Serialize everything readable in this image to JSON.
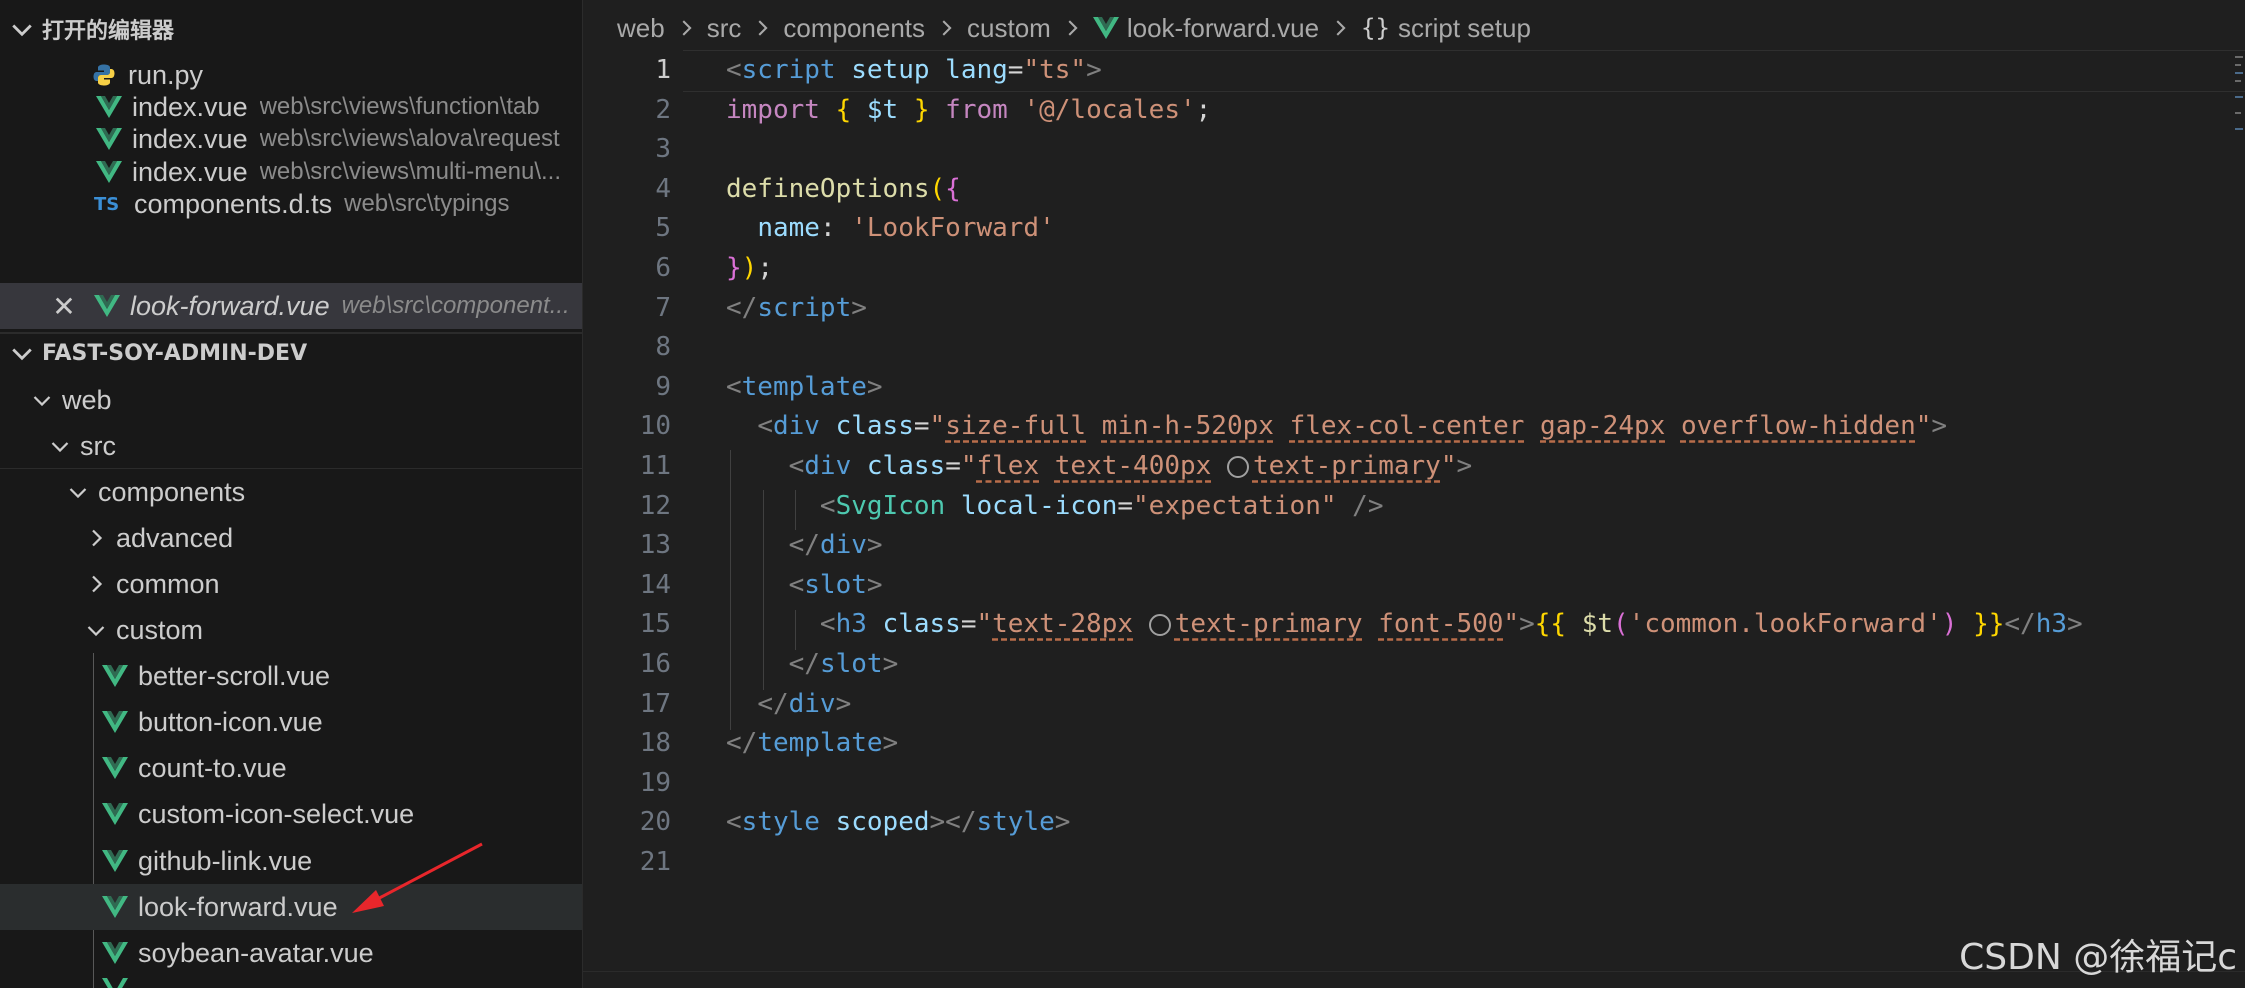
{
  "open_editors": {
    "header": "打开的编辑器",
    "items": [
      {
        "name": "run.py",
        "desc": "",
        "icon": "python-icon"
      },
      {
        "name": "index.vue",
        "desc": "web\\src\\views\\function\\tab",
        "icon": "vue-icon"
      },
      {
        "name": "index.vue",
        "desc": "web\\src\\views\\alova\\request",
        "icon": "vue-icon"
      },
      {
        "name": "index.vue",
        "desc": "web\\src\\views\\multi-menu\\...",
        "icon": "vue-icon"
      },
      {
        "name": "components.d.ts",
        "desc": "web\\src\\typings",
        "icon": "ts-icon",
        "icon_text": "TS"
      },
      {
        "name": "look-forward.vue",
        "desc": "web\\src\\component...",
        "icon": "vue-icon",
        "close": "✕"
      }
    ]
  },
  "explorer": {
    "project": "FAST-SOY-ADMIN-DEV",
    "tree": [
      {
        "label": "web",
        "type": "folder-open"
      },
      {
        "label": "src",
        "type": "folder-open"
      },
      {
        "label": "components",
        "type": "folder-open"
      },
      {
        "label": "advanced",
        "type": "folder-closed"
      },
      {
        "label": "common",
        "type": "folder-closed"
      },
      {
        "label": "custom",
        "type": "folder-open"
      },
      {
        "label": "better-scroll.vue",
        "type": "file"
      },
      {
        "label": "button-icon.vue",
        "type": "file"
      },
      {
        "label": "count-to.vue",
        "type": "file"
      },
      {
        "label": "custom-icon-select.vue",
        "type": "file"
      },
      {
        "label": "github-link.vue",
        "type": "file"
      },
      {
        "label": "look-forward.vue",
        "type": "file",
        "selected": true
      },
      {
        "label": "soybean-avatar.vue",
        "type": "file"
      }
    ]
  },
  "breadcrumb": {
    "parts": [
      "web",
      "src",
      "components",
      "custom",
      "look-forward.vue",
      "script setup"
    ],
    "symbol_icon": "{}"
  },
  "editor": {
    "current_line": 1,
    "line_numbers": [
      "1",
      "2",
      "3",
      "4",
      "5",
      "6",
      "7",
      "8",
      "9",
      "10",
      "11",
      "12",
      "13",
      "14",
      "15",
      "16",
      "17",
      "18",
      "19",
      "20",
      "21"
    ],
    "lines": [
      [
        [
          "tok-p",
          "<"
        ],
        [
          "tok-tag",
          "script"
        ],
        [
          "tok-w",
          " "
        ],
        [
          "tok-attr",
          "setup"
        ],
        [
          "tok-w",
          " "
        ],
        [
          "tok-attr",
          "lang"
        ],
        [
          "tok-w",
          "="
        ],
        [
          "tok-str",
          "\"ts\""
        ],
        [
          "tok-p",
          ">"
        ]
      ],
      [
        [
          "tok-kw",
          "import"
        ],
        [
          "tok-w",
          " "
        ],
        [
          "tok-b1",
          "{"
        ],
        [
          "tok-w",
          " "
        ],
        [
          "tok-attr",
          "$t"
        ],
        [
          "tok-w",
          " "
        ],
        [
          "tok-b1",
          "}"
        ],
        [
          "tok-w",
          " "
        ],
        [
          "tok-kw",
          "from"
        ],
        [
          "tok-w",
          " "
        ],
        [
          "tok-str",
          "'@/locales'"
        ],
        [
          "tok-w",
          ";"
        ]
      ],
      [],
      [
        [
          "tok-fn",
          "defineOptions"
        ],
        [
          "tok-b1",
          "("
        ],
        [
          "tok-b2",
          "{"
        ]
      ],
      [
        [
          "tok-w",
          "  "
        ],
        [
          "tok-attr",
          "name"
        ],
        [
          "tok-w",
          ": "
        ],
        [
          "tok-str",
          "'LookForward'"
        ]
      ],
      [
        [
          "tok-b2",
          "}"
        ],
        [
          "tok-b1",
          ")"
        ],
        [
          "tok-w",
          ";"
        ]
      ],
      [
        [
          "tok-p",
          "</"
        ],
        [
          "tok-tag",
          "script"
        ],
        [
          "tok-p",
          ">"
        ]
      ],
      [],
      [
        [
          "tok-p",
          "<"
        ],
        [
          "tok-tag",
          "template"
        ],
        [
          "tok-p",
          ">"
        ]
      ],
      [
        [
          "tok-w",
          "  "
        ],
        [
          "tok-p",
          "<"
        ],
        [
          "tok-tag",
          "div"
        ],
        [
          "tok-w",
          " "
        ],
        [
          "tok-attr",
          "class"
        ],
        [
          "tok-w",
          "="
        ],
        [
          "tok-str",
          "\""
        ],
        [
          "tok-str tok-u",
          "size-full"
        ],
        [
          "tok-str",
          " "
        ],
        [
          "tok-str tok-u",
          "min-h-520px"
        ],
        [
          "tok-str",
          " "
        ],
        [
          "tok-str tok-u",
          "flex-col-center"
        ],
        [
          "tok-str",
          " "
        ],
        [
          "tok-str tok-u",
          "gap-24px"
        ],
        [
          "tok-str",
          " "
        ],
        [
          "tok-str tok-u",
          "overflow-hidden"
        ],
        [
          "tok-str",
          "\""
        ],
        [
          "tok-p",
          ">"
        ]
      ],
      [
        [
          "tok-w",
          "    "
        ],
        [
          "tok-p",
          "<"
        ],
        [
          "tok-tag",
          "div"
        ],
        [
          "tok-w",
          " "
        ],
        [
          "tok-attr",
          "class"
        ],
        [
          "tok-w",
          "="
        ],
        [
          "tok-str",
          "\""
        ],
        [
          "tok-str tok-u",
          "flex"
        ],
        [
          "tok-str",
          " "
        ],
        [
          "tok-str tok-u",
          "text-400px"
        ],
        [
          "tok-str",
          " "
        ],
        [
          "swatch",
          ""
        ],
        [
          "tok-str tok-u",
          "text-primary"
        ],
        [
          "tok-str",
          "\""
        ],
        [
          "tok-p",
          ">"
        ]
      ],
      [
        [
          "tok-w",
          "      "
        ],
        [
          "tok-p",
          "<"
        ],
        [
          "tok-comp",
          "SvgIcon"
        ],
        [
          "tok-w",
          " "
        ],
        [
          "tok-attr",
          "local-icon"
        ],
        [
          "tok-w",
          "="
        ],
        [
          "tok-str",
          "\"expectation\""
        ],
        [
          "tok-w",
          " "
        ],
        [
          "tok-p",
          "/>"
        ]
      ],
      [
        [
          "tok-w",
          "    "
        ],
        [
          "tok-p",
          "</"
        ],
        [
          "tok-tag",
          "div"
        ],
        [
          "tok-p",
          ">"
        ]
      ],
      [
        [
          "tok-w",
          "    "
        ],
        [
          "tok-p",
          "<"
        ],
        [
          "tok-tag",
          "slot"
        ],
        [
          "tok-p",
          ">"
        ]
      ],
      [
        [
          "tok-w",
          "      "
        ],
        [
          "tok-p",
          "<"
        ],
        [
          "tok-tag",
          "h3"
        ],
        [
          "tok-w",
          " "
        ],
        [
          "tok-attr",
          "class"
        ],
        [
          "tok-w",
          "="
        ],
        [
          "tok-str",
          "\""
        ],
        [
          "tok-str tok-u",
          "text-28px"
        ],
        [
          "tok-str",
          " "
        ],
        [
          "swatch",
          ""
        ],
        [
          "tok-str tok-u",
          "text-primary"
        ],
        [
          "tok-str",
          " "
        ],
        [
          "tok-str tok-u",
          "font-500"
        ],
        [
          "tok-str",
          "\""
        ],
        [
          "tok-p",
          ">"
        ],
        [
          "tok-b1",
          "{{"
        ],
        [
          "tok-w",
          " "
        ],
        [
          "tok-fn",
          "$t"
        ],
        [
          "tok-b2",
          "("
        ],
        [
          "tok-str",
          "'common.lookForward'"
        ],
        [
          "tok-b2",
          ")"
        ],
        [
          "tok-w",
          " "
        ],
        [
          "tok-b1",
          "}}"
        ],
        [
          "tok-p",
          "</"
        ],
        [
          "tok-tag",
          "h3"
        ],
        [
          "tok-p",
          ">"
        ]
      ],
      [
        [
          "tok-w",
          "    "
        ],
        [
          "tok-p",
          "</"
        ],
        [
          "tok-tag",
          "slot"
        ],
        [
          "tok-p",
          ">"
        ]
      ],
      [
        [
          "tok-w",
          "  "
        ],
        [
          "tok-p",
          "</"
        ],
        [
          "tok-tag",
          "div"
        ],
        [
          "tok-p",
          ">"
        ]
      ],
      [
        [
          "tok-p",
          "</"
        ],
        [
          "tok-tag",
          "template"
        ],
        [
          "tok-p",
          ">"
        ]
      ],
      [],
      [
        [
          "tok-p",
          "<"
        ],
        [
          "tok-tag",
          "style"
        ],
        [
          "tok-w",
          " "
        ],
        [
          "tok-attr",
          "scoped"
        ],
        [
          "tok-p",
          "></"
        ],
        [
          "tok-tag",
          "style"
        ],
        [
          "tok-p",
          ">"
        ]
      ],
      []
    ]
  },
  "watermark": "CSDN @徐福记c",
  "colors": {
    "vue": "#41b883",
    "ts": "#3b8fd6",
    "python_blue": "#3572a5",
    "python_yellow": "#f7d046",
    "arrow": "#e8262b"
  }
}
